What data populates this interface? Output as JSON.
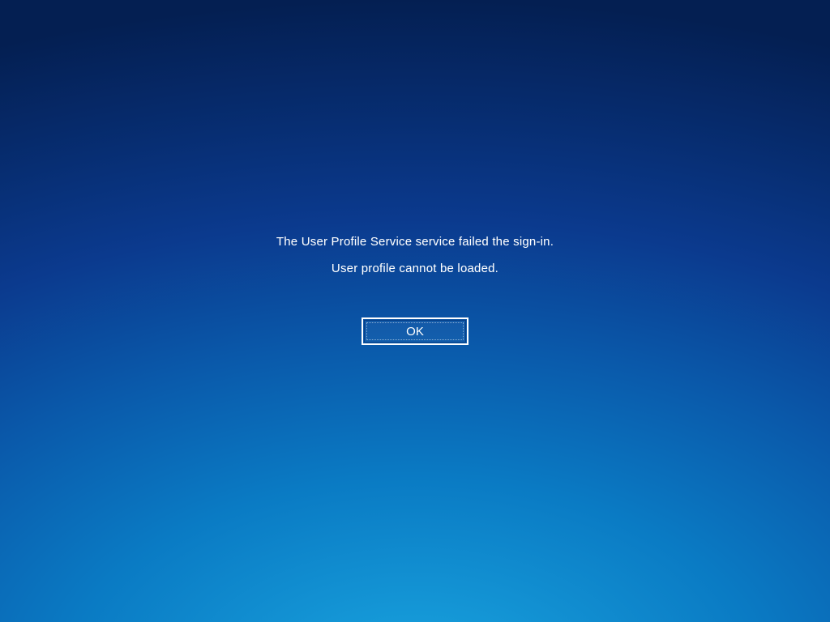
{
  "error": {
    "line1": "The User Profile Service service failed the sign-in.",
    "line2": "User profile cannot be loaded.",
    "ok_label": "OK"
  }
}
